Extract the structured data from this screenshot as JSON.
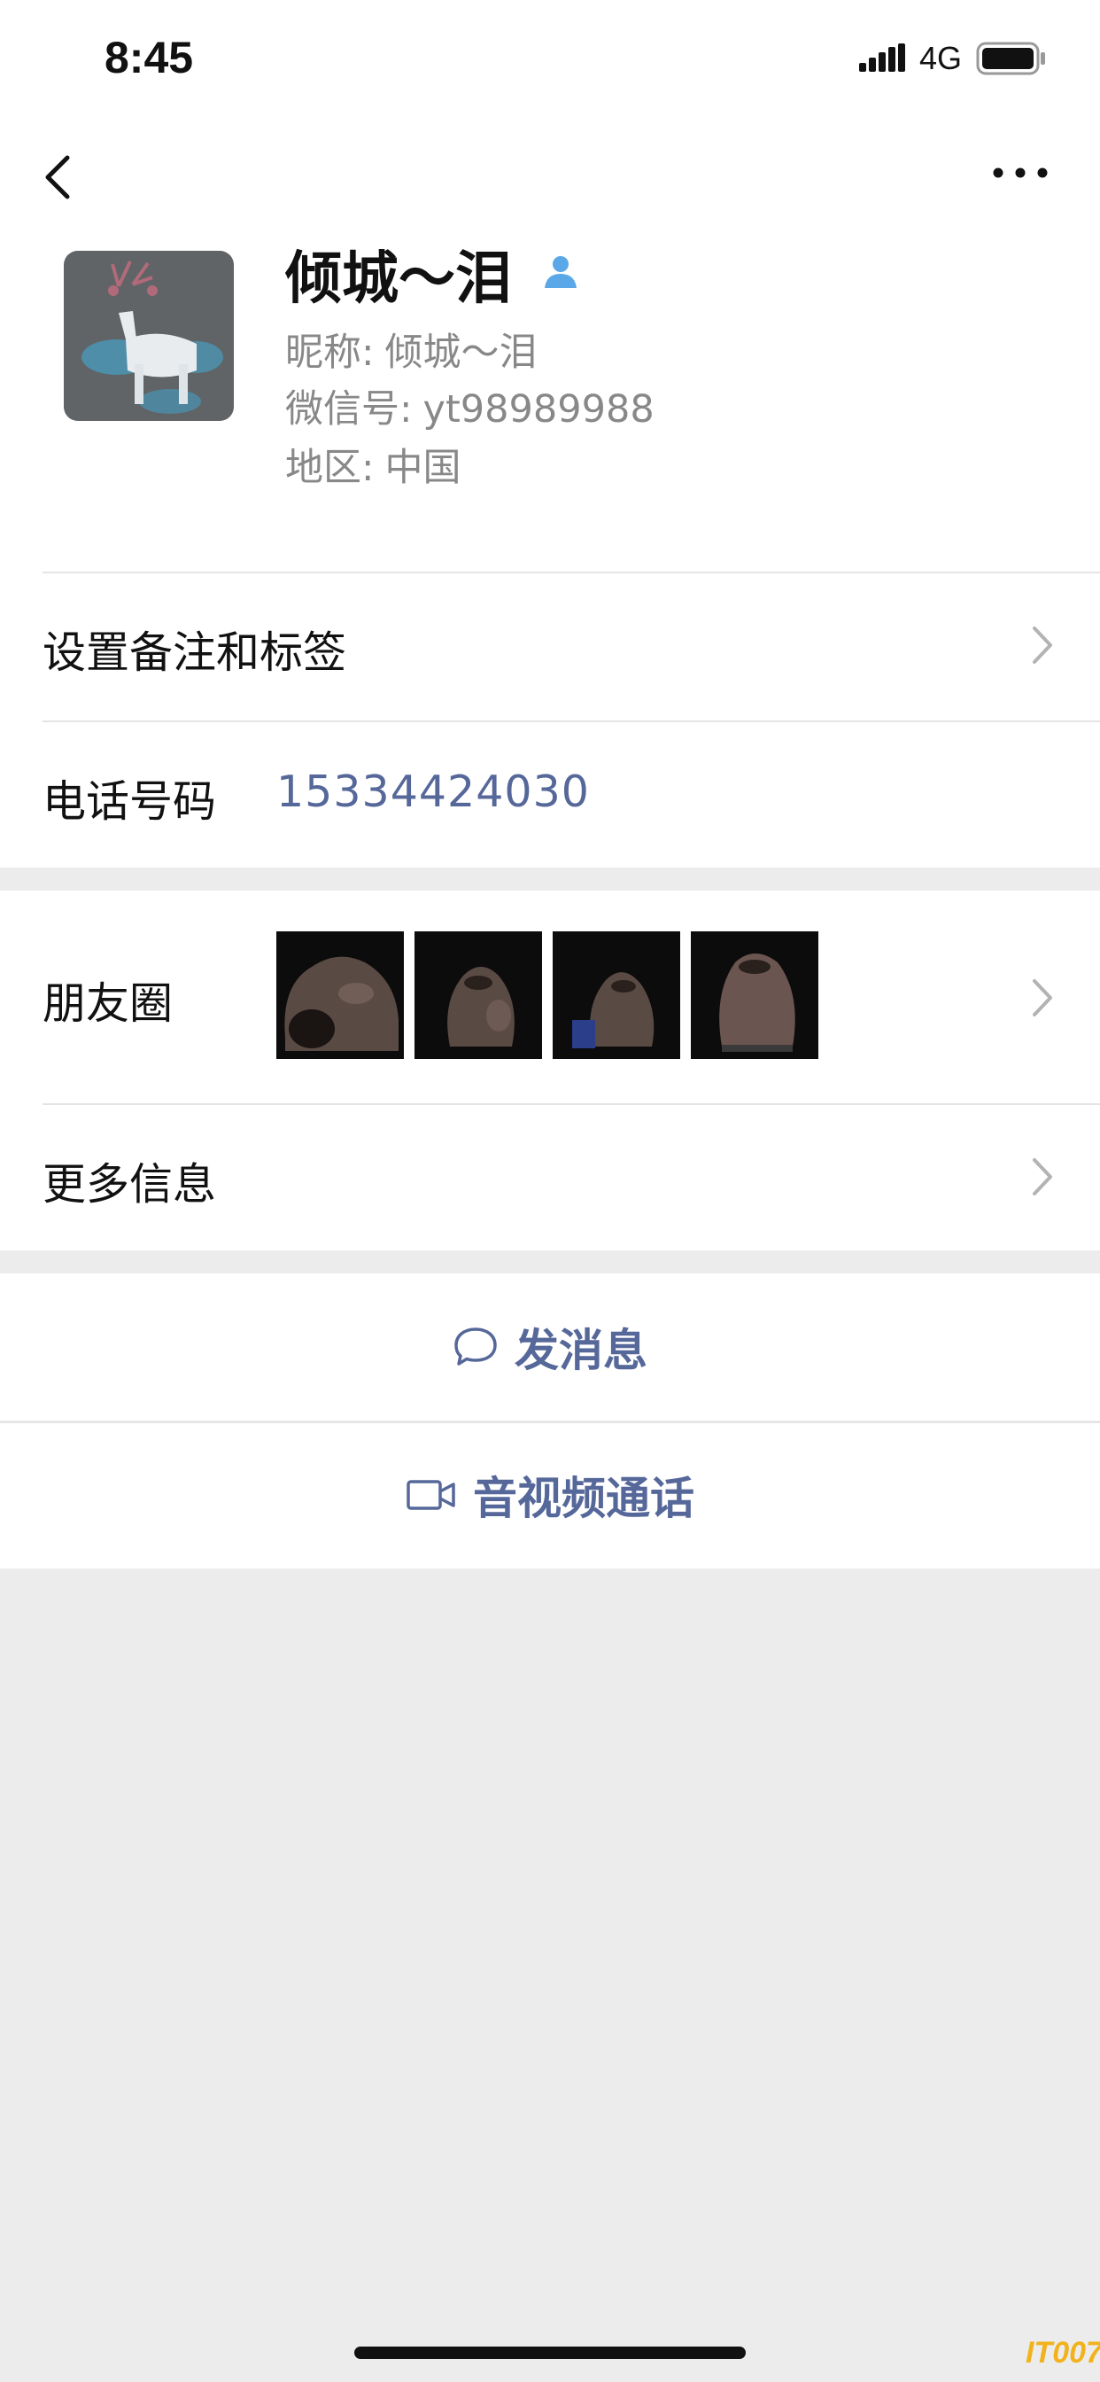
{
  "status_bar": {
    "time": "8:45",
    "network": "4G"
  },
  "nav": {
    "back_icon": "chevron-left-icon",
    "more_icon": "ellipsis-icon"
  },
  "profile": {
    "name": "倾城～泪",
    "nickname_label": "昵称:",
    "nickname": "倾城～泪",
    "wechat_id_label": "微信号:",
    "wechat_id": "yt98989988",
    "region_label": "地区:",
    "region": "中国",
    "badge_icon": "contact-person-icon"
  },
  "rows": {
    "remark_tags": "设置备注和标签",
    "phone_label": "电话号码",
    "phone_value": "15334424030",
    "moments_label": "朋友圈",
    "more_info_label": "更多信息"
  },
  "actions": {
    "message_label": "发消息",
    "message_icon": "chat-bubble-icon",
    "video_call_label": "音视频通话",
    "video_call_icon": "video-camera-icon"
  },
  "watermark": "IT007",
  "colors": {
    "link": "#56689a",
    "background": "#ececec",
    "badge": "#5aa8e8"
  }
}
